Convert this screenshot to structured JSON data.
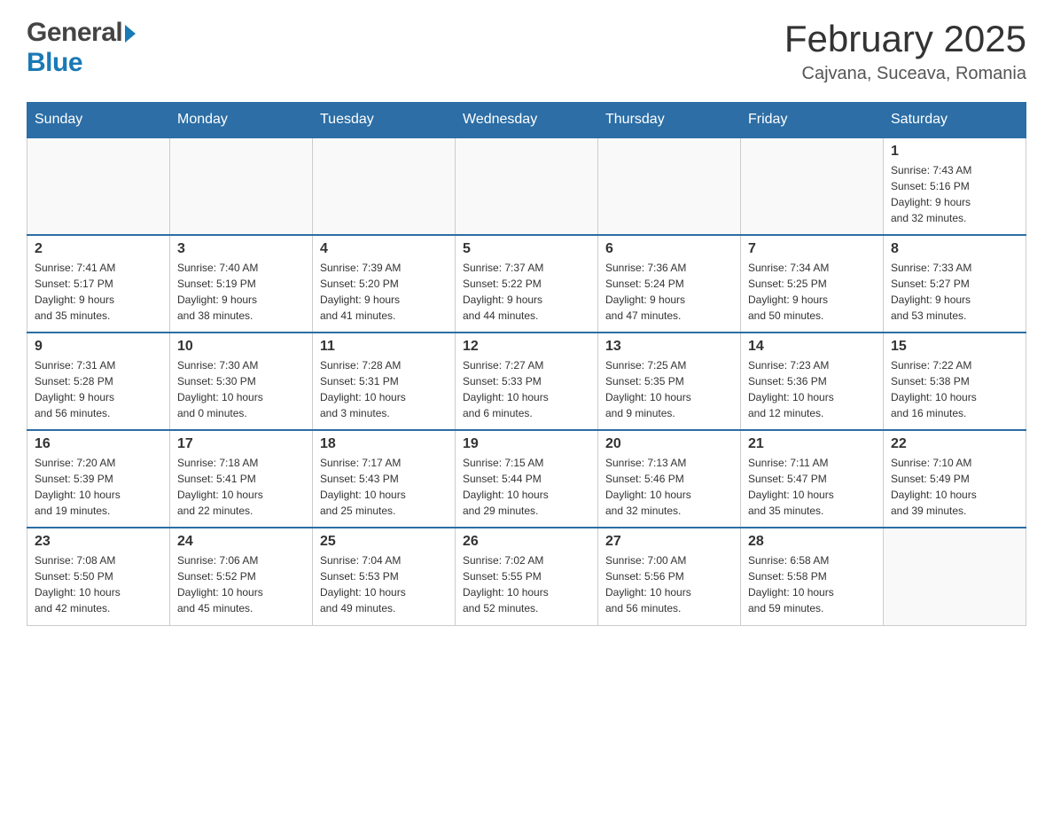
{
  "header": {
    "month_title": "February 2025",
    "location": "Cajvana, Suceava, Romania"
  },
  "logo": {
    "general": "General",
    "blue": "Blue"
  },
  "days_of_week": [
    "Sunday",
    "Monday",
    "Tuesday",
    "Wednesday",
    "Thursday",
    "Friday",
    "Saturday"
  ],
  "weeks": [
    {
      "days": [
        {
          "number": "",
          "info": ""
        },
        {
          "number": "",
          "info": ""
        },
        {
          "number": "",
          "info": ""
        },
        {
          "number": "",
          "info": ""
        },
        {
          "number": "",
          "info": ""
        },
        {
          "number": "",
          "info": ""
        },
        {
          "number": "1",
          "info": "Sunrise: 7:43 AM\nSunset: 5:16 PM\nDaylight: 9 hours\nand 32 minutes."
        }
      ]
    },
    {
      "days": [
        {
          "number": "2",
          "info": "Sunrise: 7:41 AM\nSunset: 5:17 PM\nDaylight: 9 hours\nand 35 minutes."
        },
        {
          "number": "3",
          "info": "Sunrise: 7:40 AM\nSunset: 5:19 PM\nDaylight: 9 hours\nand 38 minutes."
        },
        {
          "number": "4",
          "info": "Sunrise: 7:39 AM\nSunset: 5:20 PM\nDaylight: 9 hours\nand 41 minutes."
        },
        {
          "number": "5",
          "info": "Sunrise: 7:37 AM\nSunset: 5:22 PM\nDaylight: 9 hours\nand 44 minutes."
        },
        {
          "number": "6",
          "info": "Sunrise: 7:36 AM\nSunset: 5:24 PM\nDaylight: 9 hours\nand 47 minutes."
        },
        {
          "number": "7",
          "info": "Sunrise: 7:34 AM\nSunset: 5:25 PM\nDaylight: 9 hours\nand 50 minutes."
        },
        {
          "number": "8",
          "info": "Sunrise: 7:33 AM\nSunset: 5:27 PM\nDaylight: 9 hours\nand 53 minutes."
        }
      ]
    },
    {
      "days": [
        {
          "number": "9",
          "info": "Sunrise: 7:31 AM\nSunset: 5:28 PM\nDaylight: 9 hours\nand 56 minutes."
        },
        {
          "number": "10",
          "info": "Sunrise: 7:30 AM\nSunset: 5:30 PM\nDaylight: 10 hours\nand 0 minutes."
        },
        {
          "number": "11",
          "info": "Sunrise: 7:28 AM\nSunset: 5:31 PM\nDaylight: 10 hours\nand 3 minutes."
        },
        {
          "number": "12",
          "info": "Sunrise: 7:27 AM\nSunset: 5:33 PM\nDaylight: 10 hours\nand 6 minutes."
        },
        {
          "number": "13",
          "info": "Sunrise: 7:25 AM\nSunset: 5:35 PM\nDaylight: 10 hours\nand 9 minutes."
        },
        {
          "number": "14",
          "info": "Sunrise: 7:23 AM\nSunset: 5:36 PM\nDaylight: 10 hours\nand 12 minutes."
        },
        {
          "number": "15",
          "info": "Sunrise: 7:22 AM\nSunset: 5:38 PM\nDaylight: 10 hours\nand 16 minutes."
        }
      ]
    },
    {
      "days": [
        {
          "number": "16",
          "info": "Sunrise: 7:20 AM\nSunset: 5:39 PM\nDaylight: 10 hours\nand 19 minutes."
        },
        {
          "number": "17",
          "info": "Sunrise: 7:18 AM\nSunset: 5:41 PM\nDaylight: 10 hours\nand 22 minutes."
        },
        {
          "number": "18",
          "info": "Sunrise: 7:17 AM\nSunset: 5:43 PM\nDaylight: 10 hours\nand 25 minutes."
        },
        {
          "number": "19",
          "info": "Sunrise: 7:15 AM\nSunset: 5:44 PM\nDaylight: 10 hours\nand 29 minutes."
        },
        {
          "number": "20",
          "info": "Sunrise: 7:13 AM\nSunset: 5:46 PM\nDaylight: 10 hours\nand 32 minutes."
        },
        {
          "number": "21",
          "info": "Sunrise: 7:11 AM\nSunset: 5:47 PM\nDaylight: 10 hours\nand 35 minutes."
        },
        {
          "number": "22",
          "info": "Sunrise: 7:10 AM\nSunset: 5:49 PM\nDaylight: 10 hours\nand 39 minutes."
        }
      ]
    },
    {
      "days": [
        {
          "number": "23",
          "info": "Sunrise: 7:08 AM\nSunset: 5:50 PM\nDaylight: 10 hours\nand 42 minutes."
        },
        {
          "number": "24",
          "info": "Sunrise: 7:06 AM\nSunset: 5:52 PM\nDaylight: 10 hours\nand 45 minutes."
        },
        {
          "number": "25",
          "info": "Sunrise: 7:04 AM\nSunset: 5:53 PM\nDaylight: 10 hours\nand 49 minutes."
        },
        {
          "number": "26",
          "info": "Sunrise: 7:02 AM\nSunset: 5:55 PM\nDaylight: 10 hours\nand 52 minutes."
        },
        {
          "number": "27",
          "info": "Sunrise: 7:00 AM\nSunset: 5:56 PM\nDaylight: 10 hours\nand 56 minutes."
        },
        {
          "number": "28",
          "info": "Sunrise: 6:58 AM\nSunset: 5:58 PM\nDaylight: 10 hours\nand 59 minutes."
        },
        {
          "number": "",
          "info": ""
        }
      ]
    }
  ]
}
